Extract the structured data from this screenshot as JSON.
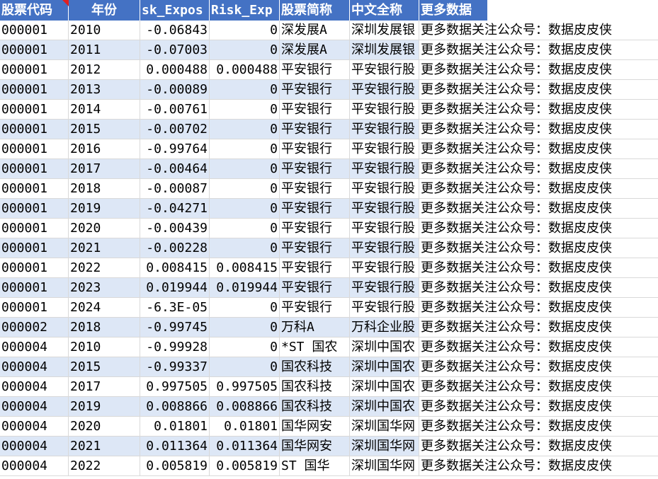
{
  "headers": [
    "股票代码",
    "年份",
    "sk_Expos",
    "Risk_Exp",
    "股票简称",
    "中文全称",
    "更多数据"
  ],
  "rows": [
    [
      "000001",
      "2010",
      "-0.06843",
      "0",
      "深发展A",
      "深圳发展银",
      "更多数据关注公众号：数据皮皮侠"
    ],
    [
      "000001",
      "2011",
      "-0.07003",
      "0",
      "深发展A",
      "深圳发展银",
      "更多数据关注公众号：数据皮皮侠"
    ],
    [
      "000001",
      "2012",
      "0.000488",
      "0.000488",
      "平安银行",
      "平安银行股",
      "更多数据关注公众号：数据皮皮侠"
    ],
    [
      "000001",
      "2013",
      "-0.00089",
      "0",
      "平安银行",
      "平安银行股",
      "更多数据关注公众号：数据皮皮侠"
    ],
    [
      "000001",
      "2014",
      "-0.00761",
      "0",
      "平安银行",
      "平安银行股",
      "更多数据关注公众号：数据皮皮侠"
    ],
    [
      "000001",
      "2015",
      "-0.00702",
      "0",
      "平安银行",
      "平安银行股",
      "更多数据关注公众号：数据皮皮侠"
    ],
    [
      "000001",
      "2016",
      "-0.99764",
      "0",
      "平安银行",
      "平安银行股",
      "更多数据关注公众号：数据皮皮侠"
    ],
    [
      "000001",
      "2017",
      "-0.00464",
      "0",
      "平安银行",
      "平安银行股",
      "更多数据关注公众号：数据皮皮侠"
    ],
    [
      "000001",
      "2018",
      "-0.00087",
      "0",
      "平安银行",
      "平安银行股",
      "更多数据关注公众号：数据皮皮侠"
    ],
    [
      "000001",
      "2019",
      "-0.04271",
      "0",
      "平安银行",
      "平安银行股",
      "更多数据关注公众号：数据皮皮侠"
    ],
    [
      "000001",
      "2020",
      "-0.00439",
      "0",
      "平安银行",
      "平安银行股",
      "更多数据关注公众号：数据皮皮侠"
    ],
    [
      "000001",
      "2021",
      "-0.00228",
      "0",
      "平安银行",
      "平安银行股",
      "更多数据关注公众号：数据皮皮侠"
    ],
    [
      "000001",
      "2022",
      "0.008415",
      "0.008415",
      "平安银行",
      "平安银行股",
      "更多数据关注公众号：数据皮皮侠"
    ],
    [
      "000001",
      "2023",
      "0.019944",
      "0.019944",
      "平安银行",
      "平安银行股",
      "更多数据关注公众号：数据皮皮侠"
    ],
    [
      "000001",
      "2024",
      "-6.3E-05",
      "0",
      "平安银行",
      "平安银行股",
      "更多数据关注公众号：数据皮皮侠"
    ],
    [
      "000002",
      "2018",
      "-0.99745",
      "0",
      "万科A",
      "万科企业股",
      "更多数据关注公众号：数据皮皮侠"
    ],
    [
      "000004",
      "2010",
      "-0.99928",
      "0",
      "*ST 国农",
      "深圳中国农",
      "更多数据关注公众号：数据皮皮侠"
    ],
    [
      "000004",
      "2015",
      "-0.99337",
      "0",
      "国农科技",
      "深圳中国农",
      "更多数据关注公众号：数据皮皮侠"
    ],
    [
      "000004",
      "2017",
      "0.997505",
      "0.997505",
      "国农科技",
      "深圳中国农",
      "更多数据关注公众号：数据皮皮侠"
    ],
    [
      "000004",
      "2019",
      "0.008866",
      "0.008866",
      "国农科技",
      "深圳中国农",
      "更多数据关注公众号：数据皮皮侠"
    ],
    [
      "000004",
      "2020",
      "0.01801",
      "0.01801",
      "国华网安",
      "深圳国华网",
      "更多数据关注公众号：数据皮皮侠"
    ],
    [
      "000004",
      "2021",
      "0.011364",
      "0.011364",
      "国华网安",
      "深圳国华网",
      "更多数据关注公众号：数据皮皮侠"
    ],
    [
      "000004",
      "2022",
      "0.005819",
      "0.005819",
      "ST 国华",
      "深圳国华网",
      "更多数据关注公众号：数据皮皮侠"
    ]
  ],
  "colors": {
    "header_bg": "#4472c4",
    "alt_row_bg": "#dde7f6",
    "comment_flag": "#e02020"
  },
  "icons": {
    "comment_indicator": "red-triangle-comment-icon"
  }
}
